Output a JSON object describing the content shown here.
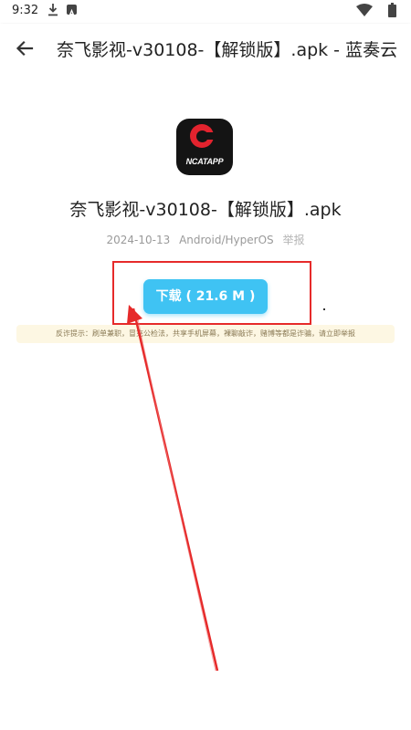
{
  "status_bar": {
    "time": "9:32",
    "icons": [
      "download-icon",
      "notification-a-icon",
      "wifi-icon",
      "battery-icon"
    ]
  },
  "app_bar": {
    "back_icon": "arrow-left-icon",
    "title": "奈飞影视-v30108-【解锁版】.apk - 蓝奏云"
  },
  "file": {
    "icon_text": "NCATAPP",
    "name": "奈飞影视-v30108-【解锁版】.apk",
    "date": "2024-10-13",
    "platform": "Android/HyperOS",
    "report_label": "举报"
  },
  "download": {
    "label": "下载 ( 21.6 M )"
  },
  "notice": {
    "text": "反诈提示：刷单兼职，冒充公检法，共享手机屏幕，裸聊敲诈，赌博等都是诈骗，请立即举报"
  },
  "colors": {
    "accent": "#3fc3f3",
    "highlight": "#e62a2a",
    "notice_bg": "#fdf7e3"
  }
}
